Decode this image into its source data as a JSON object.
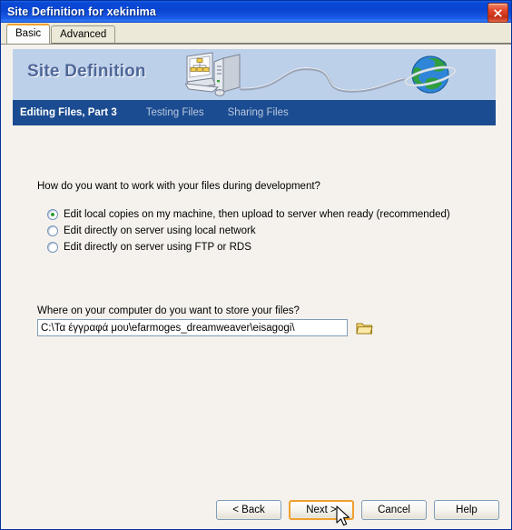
{
  "window": {
    "title": "Site Definition for xekinima",
    "close_icon": "close-icon"
  },
  "tabs": [
    {
      "label": "Basic",
      "active": true
    },
    {
      "label": "Advanced",
      "active": false
    }
  ],
  "banner": {
    "title": "Site Definition",
    "art": [
      "computer-icon",
      "network-cable-icon",
      "globe-icon"
    ],
    "bg_color": "#bdd0ea",
    "title_color": "#4f6799"
  },
  "steps": [
    {
      "label": "Editing Files, Part 3",
      "current": true
    },
    {
      "label": "Testing Files",
      "current": false
    },
    {
      "label": "Sharing Files",
      "current": false
    }
  ],
  "step_bar_color": "#1b4c91",
  "content": {
    "question": "How do you want to work with your files during development?",
    "options": [
      {
        "label": "Edit local copies on my machine, then upload to server when ready (recommended)",
        "selected": true
      },
      {
        "label": "Edit directly on server using local network",
        "selected": false
      },
      {
        "label": "Edit directly on server using FTP or RDS",
        "selected": false
      }
    ],
    "store_label": "Where on your computer do you want to store your files?",
    "path_value": "C:\\Τα έγγραφά μου\\efarmoges_dreamweaver\\eisagogi\\",
    "path_placeholder": "",
    "folder_icon": "folder-browse-icon"
  },
  "footer": {
    "buttons": [
      {
        "label": "< Back",
        "focused": false
      },
      {
        "label": "Next >",
        "focused": true
      },
      {
        "label": "Cancel",
        "focused": false
      },
      {
        "label": "Help",
        "focused": false
      }
    ],
    "focus_color": "#f0a030"
  }
}
